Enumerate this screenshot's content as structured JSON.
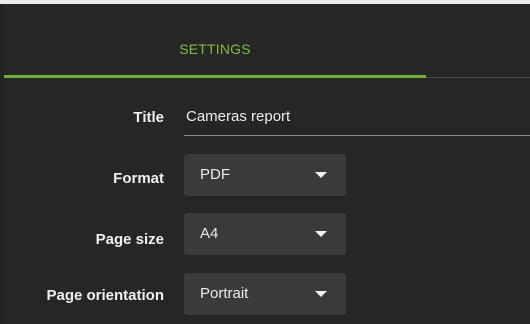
{
  "tabs": [
    {
      "label": "SETTINGS",
      "active": true
    }
  ],
  "form": {
    "title": {
      "label": "Title",
      "value": "Cameras report"
    },
    "format": {
      "label": "Format",
      "value": "PDF"
    },
    "page_size": {
      "label": "Page size",
      "value": "A4"
    },
    "page_orientation": {
      "label": "Page orientation",
      "value": "Portrait"
    }
  },
  "colors": {
    "accent": "#6ab133",
    "background": "#262626",
    "select_background": "#3a3a3a"
  },
  "icons": {
    "dropdown": "caret-down-icon"
  }
}
